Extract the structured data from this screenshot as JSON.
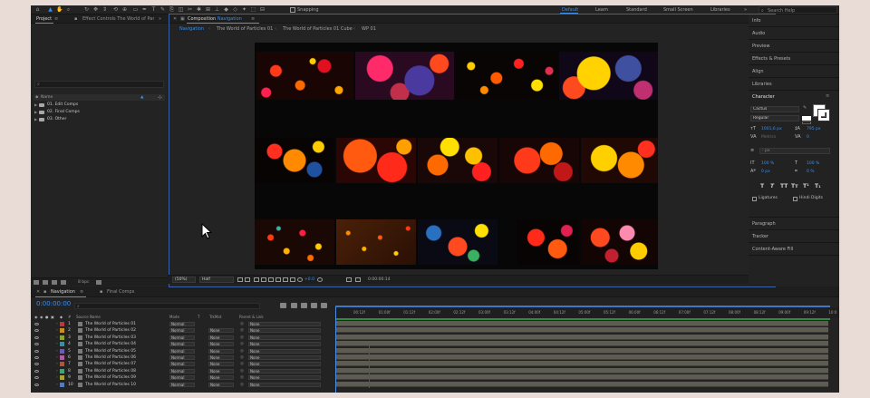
{
  "toolbar": {
    "snapping": "Snapping",
    "workspaces": [
      "Default",
      "Learn",
      "Standard",
      "Small Screen",
      "Libraries"
    ],
    "active_workspace": "Default",
    "search_placeholder": "Search Help"
  },
  "project_panel": {
    "tab_project": "Project",
    "tab_effect_controls": "Effect Controls The World of Par",
    "column_name": "Name",
    "folders": [
      "01. Edit Comps",
      "02. Final Comps",
      "03. Other"
    ],
    "bpc": "8 bpc"
  },
  "composition_panel": {
    "tab_label": "Composition",
    "tab_comp_name": "Navigation",
    "breadcrumbs": [
      "Navigation",
      "The World of Particles 01",
      "The World of Particles 01 Cube",
      "WP 01"
    ],
    "zoom": "(50%)",
    "resolution": "Half",
    "exposure": "+0.0",
    "timecode": "0:00:00:14"
  },
  "right_panel": {
    "items_top": [
      "Info",
      "Audio",
      "Preview",
      "Effects & Presets",
      "Align",
      "Libraries"
    ],
    "character_title": "Character",
    "font_family": "Cactus",
    "font_style": "Regular",
    "font_size": "1001,6 px",
    "leading": "795 px",
    "kerning": "Metrics",
    "tracking": "0",
    "stroke_width": "- px",
    "vertical_scale": "100 %",
    "horizontal_scale": "100 %",
    "baseline_shift": "0 px",
    "tsume": "0 %",
    "style_buttons": [
      "T",
      "T",
      "TT",
      "Tт",
      "T¹",
      "T₁"
    ],
    "ligatures": "Ligatures",
    "hindi_digits": "Hindi Digits",
    "items_bottom": [
      "Paragraph",
      "Tracker",
      "Content-Aware Fill"
    ]
  },
  "timeline": {
    "tab_navigation": "Navigation",
    "tab_final_comps": "Final Comps",
    "current_time": "0:00:00:00",
    "headers": {
      "source_name": "Source Name",
      "mode": "Mode",
      "t": "T",
      "trkmat": "TrkMat",
      "parent": "Parent & Link"
    },
    "ruler_labels": [
      "00:12f",
      "01:00f",
      "01:12f",
      "02:00f",
      "02:12f",
      "03:00f",
      "03:12f",
      "04:00f",
      "04:12f",
      "05:00f",
      "05:12f",
      "06:00f",
      "06:12f",
      "07:00f",
      "07:12f",
      "08:00f",
      "08:12f",
      "09:00f",
      "09:12f",
      "10:0"
    ],
    "layers": [
      {
        "num": "1",
        "name": "The World of Particles 01",
        "mode": "Normal",
        "trkmat": "",
        "parent": "None",
        "color": "#b53c3c"
      },
      {
        "num": "2",
        "name": "The World of Particles 02",
        "mode": "Normal",
        "trkmat": "None",
        "parent": "None",
        "color": "#c98d2e"
      },
      {
        "num": "3",
        "name": "The World of Particles 03",
        "mode": "Normal",
        "trkmat": "None",
        "parent": "None",
        "color": "#8aa63a"
      },
      {
        "num": "4",
        "name": "The World of Particles 04",
        "mode": "Normal",
        "trkmat": "None",
        "parent": "None",
        "color": "#3a8fa6"
      },
      {
        "num": "5",
        "name": "The World of Particles 05",
        "mode": "Normal",
        "trkmat": "None",
        "parent": "None",
        "color": "#6a5bb5"
      },
      {
        "num": "6",
        "name": "The World of Particles 06",
        "mode": "Normal",
        "trkmat": "None",
        "parent": "None",
        "color": "#b55ba0"
      },
      {
        "num": "7",
        "name": "The World of Particles 07",
        "mode": "Normal",
        "trkmat": "None",
        "parent": "None",
        "color": "#a65a3a"
      },
      {
        "num": "8",
        "name": "The World of Particles 08",
        "mode": "Normal",
        "trkmat": "None",
        "parent": "None",
        "color": "#3aa67a"
      },
      {
        "num": "9",
        "name": "The World of Particles 09",
        "mode": "Normal",
        "trkmat": "None",
        "parent": "None",
        "color": "#a6a63a"
      },
      {
        "num": "10",
        "name": "The World of Particles 10",
        "mode": "Normal",
        "trkmat": "None",
        "parent": "None",
        "color": "#5a7ab5"
      }
    ]
  },
  "colors": {
    "accent": "#3d8eea",
    "panel": "#232323",
    "background": "#e9dcd6"
  }
}
